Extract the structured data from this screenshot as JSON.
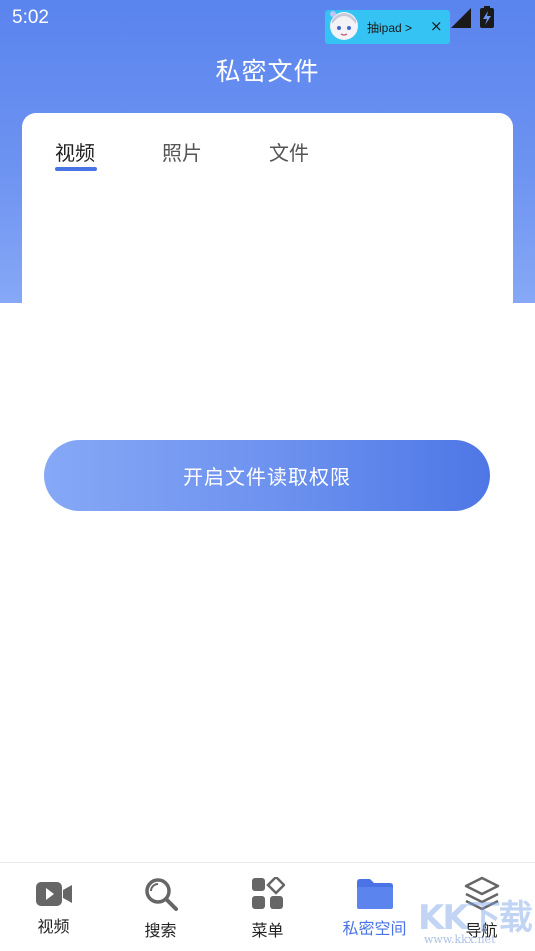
{
  "status_bar": {
    "time": "5:02"
  },
  "ad": {
    "text": "抽ipad >",
    "close": "×"
  },
  "header": {
    "title": "私密文件"
  },
  "tabs": [
    {
      "label": "视频",
      "active": true
    },
    {
      "label": "照片",
      "active": false
    },
    {
      "label": "文件",
      "active": false
    }
  ],
  "main": {
    "permission_button_label": "开启文件读取权限"
  },
  "bottom_nav": [
    {
      "label": "视频",
      "icon": "video-camera-icon",
      "active": false
    },
    {
      "label": "搜索",
      "icon": "search-icon",
      "active": false
    },
    {
      "label": "菜单",
      "icon": "menu-grid-icon",
      "active": false
    },
    {
      "label": "私密空间",
      "icon": "folder-icon",
      "active": true
    },
    {
      "label": "导航",
      "icon": "layers-icon",
      "active": false
    }
  ],
  "watermark": {
    "text": "KK下载",
    "url": "www.kkx.net"
  },
  "colors": {
    "accent": "#4a74e6",
    "header_top": "#5a84ee",
    "ad_bg": "#34c3f2"
  }
}
